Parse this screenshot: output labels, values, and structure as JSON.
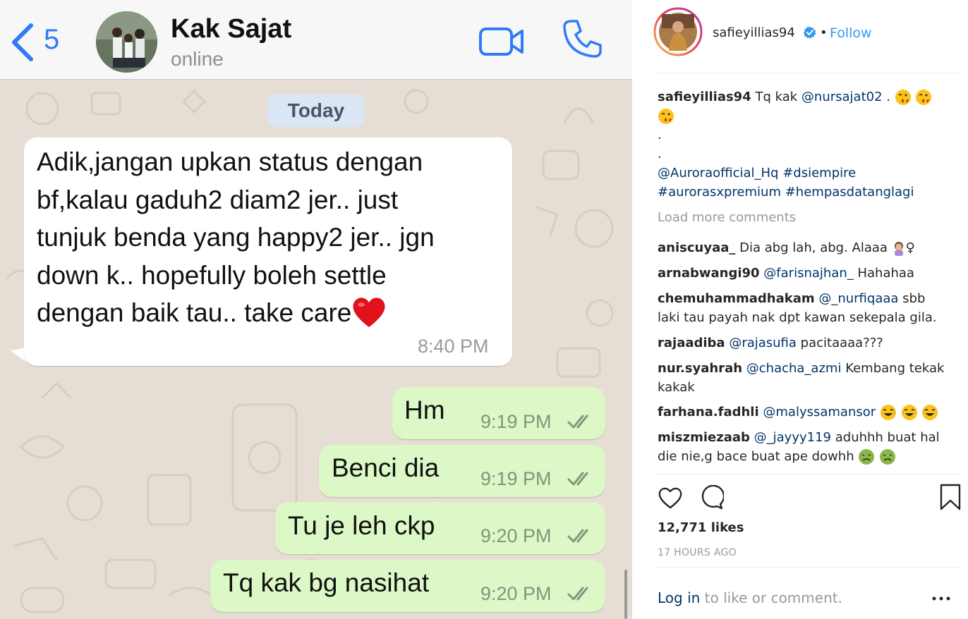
{
  "chat": {
    "back_count": "5",
    "contact_name": "Kak Sajat",
    "contact_status": "online",
    "date_label": "Today",
    "incoming": {
      "lines": [
        "Adik,jangan upkan status dengan",
        "bf,kalau gaduh2 diam2 jer.. just",
        "tunjuk benda yang happy2 jer.. jgn",
        "down k.. hopefully boleh settle",
        "dengan baik tau.. take care"
      ],
      "emoji": "red-heart",
      "time": "8:40 PM"
    },
    "outgoing": [
      {
        "text": "Hm",
        "time": "9:19 PM"
      },
      {
        "text": "Benci dia",
        "time": "9:19 PM"
      },
      {
        "text": "Tu je leh ckp",
        "time": "9:20 PM"
      },
      {
        "text": "Tq kak bg nasihat",
        "time": "9:20 PM"
      }
    ],
    "colors": {
      "accent": "#2f7cf6",
      "incoming_bubble": "#ffffff",
      "outgoing_bubble": "#dcf8c6",
      "wallpaper": "#e6ddd4"
    }
  },
  "instagram": {
    "username": "safieyillias94",
    "dot": "•",
    "follow_label": "Follow",
    "caption": {
      "user": "safieyillias94",
      "text_before": "Tq kak",
      "mention": "@nursajat02",
      "text_after": ".",
      "dot1": ".",
      "dot2": ".",
      "tag_line1": [
        "@Auroraofficial_Hq",
        "#dsiempire"
      ],
      "tag_line2": [
        "#aurorasxpremium",
        "#hempasdatanglagi"
      ]
    },
    "load_more": "Load more comments",
    "comments": [
      {
        "user": "aniscuyaa_",
        "line1": "Dia abg lah, abg. Alaaa",
        "suffix": "♀"
      },
      {
        "user": "arnabwangi90",
        "mention": "@farisnajhan_",
        "line1": "Hahahaa"
      },
      {
        "user": "chemuhammadhakam",
        "mention": "@_nurfiqaaa",
        "line1": "sbb",
        "line2": "laki tau payah nak dpt kawan sekepala gila."
      },
      {
        "user": "rajaadiba",
        "mention": "@rajasufia",
        "line1": "pacitaaaa???"
      },
      {
        "user": "nur.syahrah",
        "mention": "@chacha_azmi",
        "line1": "Kembang tekak",
        "line2": "kakak"
      },
      {
        "user": "farhana.fadhli",
        "mention": "@malyssamansor",
        "line1": ""
      },
      {
        "user": "miszmiezaab",
        "mention": "@_jayyy119",
        "line1": "aduhhh buat hal",
        "line2": "die nie,g bace buat ape dowhh"
      }
    ],
    "likes": "12,771 likes",
    "timestamp": "17 HOURS AGO",
    "login_link": "Log in",
    "login_rest": "to like or comment.",
    "colors": {
      "link": "#003569",
      "follow": "#3897f0",
      "muted": "#999999"
    }
  }
}
